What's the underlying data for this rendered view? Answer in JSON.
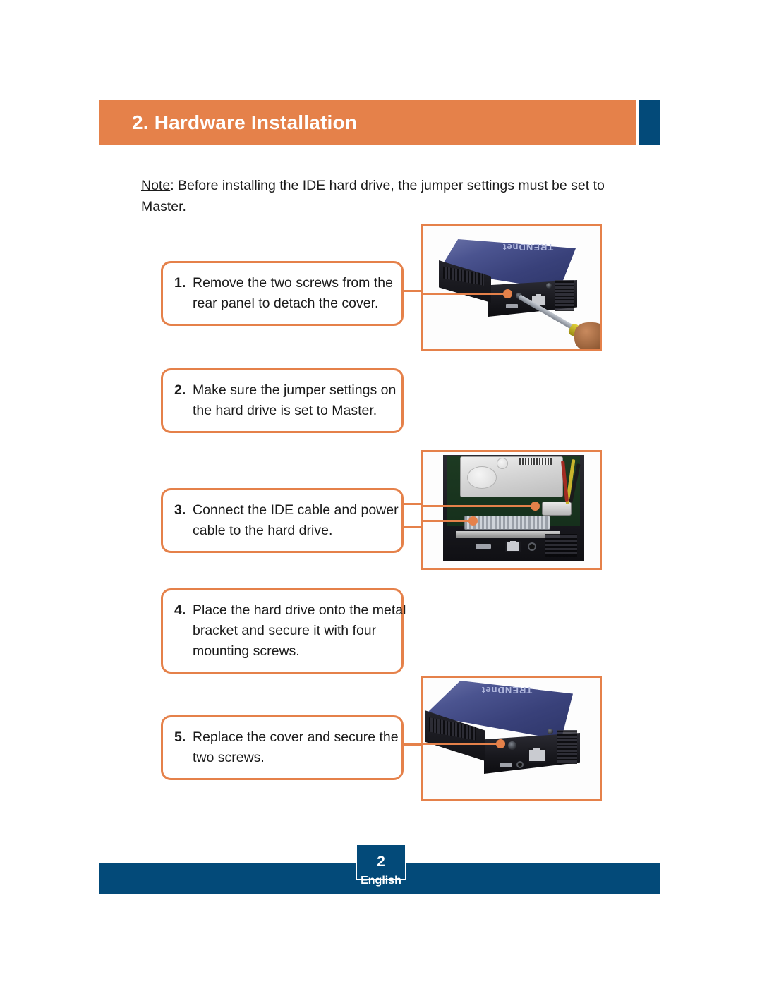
{
  "document": {
    "header": {
      "title": "2. Hardware Installation",
      "bar_color": "#e5814a",
      "accent_color": "#034a79"
    },
    "note": {
      "label": "Note",
      "text": ": Before installing the IDE hard drive, the jumper settings must be set to Master."
    },
    "steps": [
      {
        "number": "1.",
        "lines": [
          "Remove the two screws from the",
          "rear panel to detach the cover."
        ],
        "image_caption": "external-enclosure-rear-screw-removal"
      },
      {
        "number": "2.",
        "lines": [
          "Make sure the jumper settings on",
          "the hard drive is set to Master."
        ],
        "image_caption": ""
      },
      {
        "number": "3.",
        "lines": [
          "Connect the IDE cable and power",
          "cable to the hard drive."
        ],
        "image_caption": "open-enclosure-ide-and-power-cable"
      },
      {
        "number": "4.",
        "lines": [
          "Place the hard drive onto the metal",
          "bracket and secure it with four",
          "mounting screws."
        ],
        "image_caption": ""
      },
      {
        "number": "5.",
        "lines": [
          "Replace the cover and secure the",
          "two screws."
        ],
        "image_caption": "assembled-enclosure-rear-panel"
      }
    ],
    "photos": {
      "brand_text": "TRENDnet"
    },
    "footer": {
      "page_number": "2",
      "language": "English",
      "bar_color": "#034a79"
    }
  }
}
